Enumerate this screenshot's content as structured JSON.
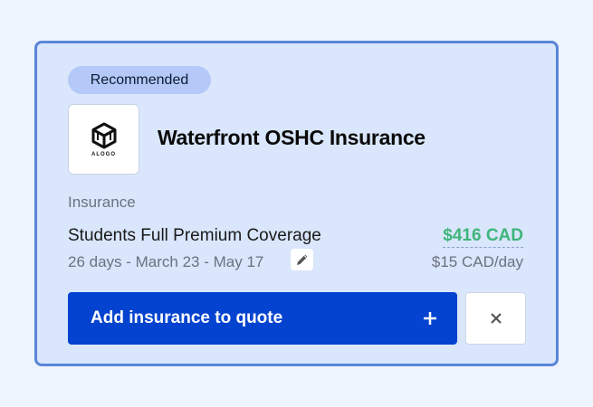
{
  "card": {
    "badge": "Recommended",
    "logo_text": "ALOGO",
    "title": "Waterfront OSHC Insurance",
    "category": "Insurance",
    "plan_name": "Students Full Premium Coverage",
    "dates": "26 days - March 23 - May 17",
    "price": "$416 CAD",
    "per_day": "$15 CAD/day",
    "add_button_label": "Add insurance to quote"
  },
  "icons": {
    "logo": "alogo-cube-icon",
    "edit": "pencil-icon",
    "add": "plus-icon",
    "close": "close-icon"
  },
  "colors": {
    "card_background": "#d9e6fb",
    "card_border": "#5a86d8",
    "badge_background": "#b4c9f7",
    "price": "#3fb57b",
    "primary_button": "#0343cf"
  }
}
